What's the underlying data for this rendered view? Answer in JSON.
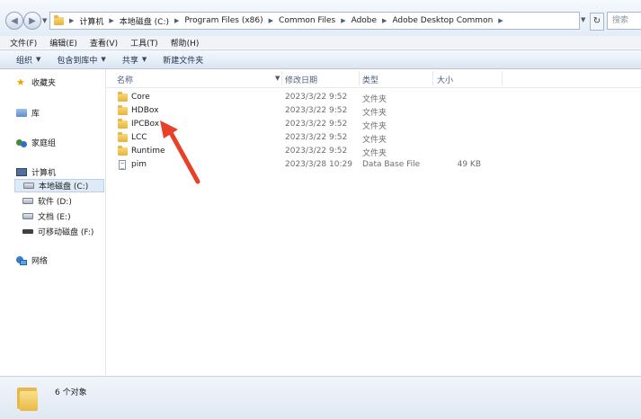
{
  "address": {
    "crumbs": [
      "计算机",
      "本地磁盘 (C:)",
      "Program Files (x86)",
      "Common Files",
      "Adobe",
      "Adobe Desktop Common"
    ],
    "search_placeholder": "搜索"
  },
  "menu": [
    "文件(F)",
    "编辑(E)",
    "查看(V)",
    "工具(T)",
    "帮助(H)"
  ],
  "commands": {
    "organize": "组织",
    "include_library": "包含到库中",
    "share": "共享",
    "new_folder": "新建文件夹"
  },
  "nav": {
    "favorites": "收藏夹",
    "libraries": "库",
    "homegroup": "家庭组",
    "computer": "计算机",
    "drives": [
      "本地磁盘 (C:)",
      "软件 (D:)",
      "文档 (E:)",
      "可移动磁盘 (F:)"
    ],
    "network": "网络"
  },
  "columns": {
    "name": "名称",
    "date": "修改日期",
    "type": "类型",
    "size": "大小"
  },
  "files": [
    {
      "name": "Core",
      "date": "2023/3/22 9:52",
      "type": "文件夹",
      "size": ""
    },
    {
      "name": "HDBox",
      "date": "2023/3/22 9:52",
      "type": "文件夹",
      "size": ""
    },
    {
      "name": "IPCBox",
      "date": "2023/3/22 9:52",
      "type": "文件夹",
      "size": ""
    },
    {
      "name": "LCC",
      "date": "2023/3/22 9:52",
      "type": "文件夹",
      "size": ""
    },
    {
      "name": "Runtime",
      "date": "2023/3/22 9:52",
      "type": "文件夹",
      "size": ""
    },
    {
      "name": "pim",
      "date": "2023/3/28 10:29",
      "type": "Data Base File",
      "size": "49 KB"
    }
  ],
  "status": {
    "count": "6 个对象"
  },
  "colors": {
    "arrow": "#e8412a",
    "selection": "#dfeaf7"
  }
}
